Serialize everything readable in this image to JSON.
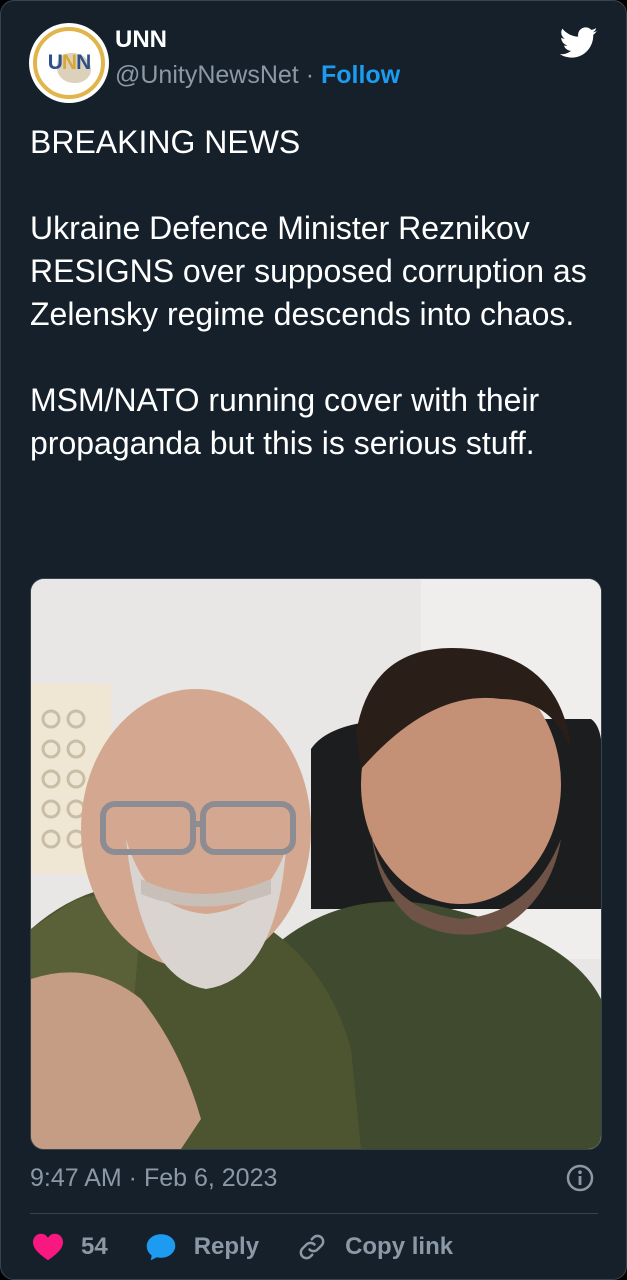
{
  "author": {
    "display_name": "UNN",
    "handle": "@UnityNewsNet",
    "separator": "·",
    "follow_label": "Follow",
    "avatar_text": "UNN"
  },
  "tweet": {
    "text": "BREAKING NEWS\n\nUkraine Defence Minister Reznikov RESIGNS over supposed corruption as Zelensky regime descends into chaos.\n\nMSM/NATO running cover with their propaganda but this is serious stuff.",
    "timestamp": "9:47 AM · Feb 6, 2023"
  },
  "actions": {
    "like_count": "54",
    "reply_label": "Reply",
    "copy_link_label": "Copy link"
  },
  "icons": {
    "brand": "twitter-bird-icon",
    "info": "info-icon",
    "like": "heart-icon",
    "reply": "speech-bubble-icon",
    "copy": "link-icon"
  },
  "colors": {
    "background": "#15202b",
    "text": "#ffffff",
    "muted": "#8b98a5",
    "accent": "#1d9bf0",
    "like": "#f91880"
  }
}
